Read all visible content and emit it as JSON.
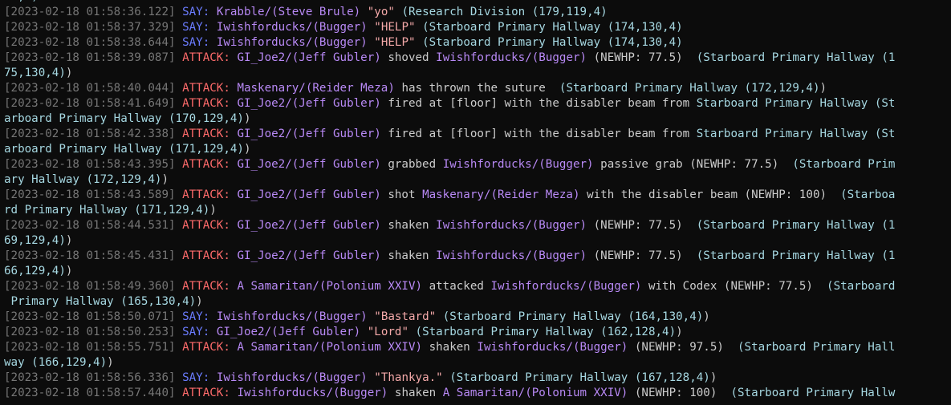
{
  "tags": {
    "say": "SAY:",
    "attack": "ATTACK:"
  },
  "colors": {
    "background": "#0c0c0c",
    "timestamp": "#767676",
    "say_tag": "#6b7cff",
    "attack_tag": "#ff6b6b",
    "actor": "#b889f5",
    "quote": "#f4a9a9",
    "location": "#a6d8e2",
    "text": "#cccccc"
  },
  "entries": [
    {
      "type": "cut",
      "segments": [
        {
          "c": "loc",
          "t": "17,4)"
        }
      ]
    },
    {
      "type": "say",
      "segments": [
        {
          "c": "ts",
          "t": "[2023-02-18 01:58:36.122]"
        },
        {
          "c": "txt",
          "t": " "
        },
        {
          "c": "say",
          "t": "SAY:"
        },
        {
          "c": "txt",
          "t": " "
        },
        {
          "c": "actor",
          "t": "Krabble/(Steve Brule)"
        },
        {
          "c": "txt",
          "t": " "
        },
        {
          "c": "quote",
          "t": "\"yo\""
        },
        {
          "c": "txt",
          "t": " "
        },
        {
          "c": "loc",
          "t": "(Research Division (179,119,4)"
        }
      ]
    },
    {
      "type": "say",
      "segments": [
        {
          "c": "ts",
          "t": "[2023-02-18 01:58:37.329]"
        },
        {
          "c": "txt",
          "t": " "
        },
        {
          "c": "say",
          "t": "SAY:"
        },
        {
          "c": "txt",
          "t": " "
        },
        {
          "c": "actor",
          "t": "Iwishforducks/(Bugger)"
        },
        {
          "c": "txt",
          "t": " "
        },
        {
          "c": "quote",
          "t": "\"HELP\""
        },
        {
          "c": "txt",
          "t": " "
        },
        {
          "c": "loc",
          "t": "(Starboard Primary Hallway (174,130,4)"
        }
      ]
    },
    {
      "type": "say",
      "segments": [
        {
          "c": "ts",
          "t": "[2023-02-18 01:58:38.644]"
        },
        {
          "c": "txt",
          "t": " "
        },
        {
          "c": "say",
          "t": "SAY:"
        },
        {
          "c": "txt",
          "t": " "
        },
        {
          "c": "actor",
          "t": "Iwishforducks/(Bugger)"
        },
        {
          "c": "txt",
          "t": " "
        },
        {
          "c": "quote",
          "t": "\"HELP\""
        },
        {
          "c": "txt",
          "t": " "
        },
        {
          "c": "loc",
          "t": "(Starboard Primary Hallway (174,130,4)"
        }
      ]
    },
    {
      "type": "attack",
      "segments": [
        {
          "c": "ts",
          "t": "[2023-02-18 01:58:39.087]"
        },
        {
          "c": "txt",
          "t": " "
        },
        {
          "c": "atk",
          "t": "ATTACK:"
        },
        {
          "c": "txt",
          "t": " "
        },
        {
          "c": "actor",
          "t": "GI_Joe2/(Jeff Gubler)"
        },
        {
          "c": "txt",
          "t": " shoved "
        },
        {
          "c": "actor",
          "t": "Iwishforducks/(Bugger)"
        },
        {
          "c": "txt",
          "t": " (NEWHP: 77.5)  "
        },
        {
          "c": "loc",
          "t": "(Starboard Primary Hallway (1"
        }
      ]
    },
    {
      "type": "wrap",
      "segments": [
        {
          "c": "loc",
          "t": "75,130,4)"
        },
        {
          "c": "txt",
          "t": ")"
        }
      ]
    },
    {
      "type": "attack",
      "segments": [
        {
          "c": "ts",
          "t": "[2023-02-18 01:58:40.044]"
        },
        {
          "c": "txt",
          "t": " "
        },
        {
          "c": "atk",
          "t": "ATTACK:"
        },
        {
          "c": "txt",
          "t": " "
        },
        {
          "c": "actor",
          "t": "Maskenary/(Reider Meza)"
        },
        {
          "c": "txt",
          "t": " has thrown the suture  "
        },
        {
          "c": "loc",
          "t": "(Starboard Primary Hallway (172,129,4)"
        },
        {
          "c": "txt",
          "t": ")"
        }
      ]
    },
    {
      "type": "attack",
      "segments": [
        {
          "c": "ts",
          "t": "[2023-02-18 01:58:41.649]"
        },
        {
          "c": "txt",
          "t": " "
        },
        {
          "c": "atk",
          "t": "ATTACK:"
        },
        {
          "c": "txt",
          "t": " "
        },
        {
          "c": "actor",
          "t": "GI_Joe2/(Jeff Gubler)"
        },
        {
          "c": "txt",
          "t": " fired at [floor] with the disabler beam from "
        },
        {
          "c": "loc",
          "t": "Starboard Primary Hallway (St"
        }
      ]
    },
    {
      "type": "wrap",
      "segments": [
        {
          "c": "loc",
          "t": "arboard Primary Hallway (170,129,4)"
        },
        {
          "c": "txt",
          "t": ")"
        }
      ]
    },
    {
      "type": "attack",
      "segments": [
        {
          "c": "ts",
          "t": "[2023-02-18 01:58:42.338]"
        },
        {
          "c": "txt",
          "t": " "
        },
        {
          "c": "atk",
          "t": "ATTACK:"
        },
        {
          "c": "txt",
          "t": " "
        },
        {
          "c": "actor",
          "t": "GI_Joe2/(Jeff Gubler)"
        },
        {
          "c": "txt",
          "t": " fired at [floor] with the disabler beam from "
        },
        {
          "c": "loc",
          "t": "Starboard Primary Hallway (St"
        }
      ]
    },
    {
      "type": "wrap",
      "segments": [
        {
          "c": "loc",
          "t": "arboard Primary Hallway (171,129,4)"
        },
        {
          "c": "txt",
          "t": ")"
        }
      ]
    },
    {
      "type": "attack",
      "segments": [
        {
          "c": "ts",
          "t": "[2023-02-18 01:58:43.395]"
        },
        {
          "c": "txt",
          "t": " "
        },
        {
          "c": "atk",
          "t": "ATTACK:"
        },
        {
          "c": "txt",
          "t": " "
        },
        {
          "c": "actor",
          "t": "GI_Joe2/(Jeff Gubler)"
        },
        {
          "c": "txt",
          "t": " grabbed "
        },
        {
          "c": "actor",
          "t": "Iwishforducks/(Bugger)"
        },
        {
          "c": "txt",
          "t": " passive grab (NEWHP: 77.5)  "
        },
        {
          "c": "loc",
          "t": "(Starboard Prim"
        }
      ]
    },
    {
      "type": "wrap",
      "segments": [
        {
          "c": "loc",
          "t": "ary Hallway (172,129,4)"
        },
        {
          "c": "txt",
          "t": ")"
        }
      ]
    },
    {
      "type": "attack",
      "segments": [
        {
          "c": "ts",
          "t": "[2023-02-18 01:58:43.589]"
        },
        {
          "c": "txt",
          "t": " "
        },
        {
          "c": "atk",
          "t": "ATTACK:"
        },
        {
          "c": "txt",
          "t": " "
        },
        {
          "c": "actor",
          "t": "GI_Joe2/(Jeff Gubler)"
        },
        {
          "c": "txt",
          "t": " shot "
        },
        {
          "c": "actor",
          "t": "Maskenary/(Reider Meza)"
        },
        {
          "c": "txt",
          "t": " with the disabler beam (NEWHP: 100)  "
        },
        {
          "c": "loc",
          "t": "(Starboa"
        }
      ]
    },
    {
      "type": "wrap",
      "segments": [
        {
          "c": "loc",
          "t": "rd Primary Hallway (171,129,4)"
        },
        {
          "c": "txt",
          "t": ")"
        }
      ]
    },
    {
      "type": "attack",
      "segments": [
        {
          "c": "ts",
          "t": "[2023-02-18 01:58:44.531]"
        },
        {
          "c": "txt",
          "t": " "
        },
        {
          "c": "atk",
          "t": "ATTACK:"
        },
        {
          "c": "txt",
          "t": " "
        },
        {
          "c": "actor",
          "t": "GI_Joe2/(Jeff Gubler)"
        },
        {
          "c": "txt",
          "t": " shaken "
        },
        {
          "c": "actor",
          "t": "Iwishforducks/(Bugger)"
        },
        {
          "c": "txt",
          "t": " (NEWHP: 77.5)  "
        },
        {
          "c": "loc",
          "t": "(Starboard Primary Hallway (1"
        }
      ]
    },
    {
      "type": "wrap",
      "segments": [
        {
          "c": "loc",
          "t": "69,129,4)"
        },
        {
          "c": "txt",
          "t": ")"
        }
      ]
    },
    {
      "type": "attack",
      "segments": [
        {
          "c": "ts",
          "t": "[2023-02-18 01:58:45.431]"
        },
        {
          "c": "txt",
          "t": " "
        },
        {
          "c": "atk",
          "t": "ATTACK:"
        },
        {
          "c": "txt",
          "t": " "
        },
        {
          "c": "actor",
          "t": "GI_Joe2/(Jeff Gubler)"
        },
        {
          "c": "txt",
          "t": " shaken "
        },
        {
          "c": "actor",
          "t": "Iwishforducks/(Bugger)"
        },
        {
          "c": "txt",
          "t": " (NEWHP: 77.5)  "
        },
        {
          "c": "loc",
          "t": "(Starboard Primary Hallway (1"
        }
      ]
    },
    {
      "type": "wrap",
      "segments": [
        {
          "c": "loc",
          "t": "66,129,4)"
        },
        {
          "c": "txt",
          "t": ")"
        }
      ]
    },
    {
      "type": "attack",
      "segments": [
        {
          "c": "ts",
          "t": "[2023-02-18 01:58:49.360]"
        },
        {
          "c": "txt",
          "t": " "
        },
        {
          "c": "atk",
          "t": "ATTACK:"
        },
        {
          "c": "txt",
          "t": " "
        },
        {
          "c": "actor",
          "t": "A Samaritan/(Polonium XXIV)"
        },
        {
          "c": "txt",
          "t": " attacked "
        },
        {
          "c": "actor",
          "t": "Iwishforducks/(Bugger)"
        },
        {
          "c": "txt",
          "t": " with Codex (NEWHP: 77.5)  "
        },
        {
          "c": "loc",
          "t": "(Starboard"
        }
      ]
    },
    {
      "type": "wrap",
      "segments": [
        {
          "c": "loc",
          "t": " Primary Hallway (165,130,4)"
        },
        {
          "c": "txt",
          "t": ")"
        }
      ]
    },
    {
      "type": "say",
      "segments": [
        {
          "c": "ts",
          "t": "[2023-02-18 01:58:50.071]"
        },
        {
          "c": "txt",
          "t": " "
        },
        {
          "c": "say",
          "t": "SAY:"
        },
        {
          "c": "txt",
          "t": " "
        },
        {
          "c": "actor",
          "t": "Iwishforducks/(Bugger)"
        },
        {
          "c": "txt",
          "t": " "
        },
        {
          "c": "quote",
          "t": "\"Bastard\""
        },
        {
          "c": "txt",
          "t": " "
        },
        {
          "c": "loc",
          "t": "(Starboard Primary Hallway (164,130,4)"
        },
        {
          "c": "txt",
          "t": ")"
        }
      ]
    },
    {
      "type": "say",
      "segments": [
        {
          "c": "ts",
          "t": "[2023-02-18 01:58:50.253]"
        },
        {
          "c": "txt",
          "t": " "
        },
        {
          "c": "say",
          "t": "SAY:"
        },
        {
          "c": "txt",
          "t": " "
        },
        {
          "c": "actor",
          "t": "GI_Joe2/(Jeff Gubler)"
        },
        {
          "c": "txt",
          "t": " "
        },
        {
          "c": "quote",
          "t": "\"Lord\""
        },
        {
          "c": "txt",
          "t": " "
        },
        {
          "c": "loc",
          "t": "(Starboard Primary Hallway (162,128,4)"
        },
        {
          "c": "txt",
          "t": ")"
        }
      ]
    },
    {
      "type": "attack",
      "segments": [
        {
          "c": "ts",
          "t": "[2023-02-18 01:58:55.751]"
        },
        {
          "c": "txt",
          "t": " "
        },
        {
          "c": "atk",
          "t": "ATTACK:"
        },
        {
          "c": "txt",
          "t": " "
        },
        {
          "c": "actor",
          "t": "A Samaritan/(Polonium XXIV)"
        },
        {
          "c": "txt",
          "t": " shaken "
        },
        {
          "c": "actor",
          "t": "Iwishforducks/(Bugger)"
        },
        {
          "c": "txt",
          "t": " (NEWHP: 97.5)  "
        },
        {
          "c": "loc",
          "t": "(Starboard Primary Hall"
        }
      ]
    },
    {
      "type": "wrap",
      "segments": [
        {
          "c": "loc",
          "t": "way (166,129,4)"
        },
        {
          "c": "txt",
          "t": ")"
        }
      ]
    },
    {
      "type": "say",
      "segments": [
        {
          "c": "ts",
          "t": "[2023-02-18 01:58:56.336]"
        },
        {
          "c": "txt",
          "t": " "
        },
        {
          "c": "say",
          "t": "SAY:"
        },
        {
          "c": "txt",
          "t": " "
        },
        {
          "c": "actor",
          "t": "Iwishforducks/(Bugger)"
        },
        {
          "c": "txt",
          "t": " "
        },
        {
          "c": "quote",
          "t": "\"Thankya.\""
        },
        {
          "c": "txt",
          "t": " "
        },
        {
          "c": "loc",
          "t": "(Starboard Primary Hallway (167,128,4)"
        },
        {
          "c": "txt",
          "t": ")"
        }
      ]
    },
    {
      "type": "attack",
      "segments": [
        {
          "c": "ts",
          "t": "[2023-02-18 01:58:57.440]"
        },
        {
          "c": "txt",
          "t": " "
        },
        {
          "c": "atk",
          "t": "ATTACK:"
        },
        {
          "c": "txt",
          "t": " "
        },
        {
          "c": "actor",
          "t": "Iwishforducks/(Bugger)"
        },
        {
          "c": "txt",
          "t": " shaken "
        },
        {
          "c": "actor",
          "t": "A Samaritan/(Polonium XXIV)"
        },
        {
          "c": "txt",
          "t": " (NEWHP: 100)  "
        },
        {
          "c": "loc",
          "t": "(Starboard Primary Hallw"
        }
      ]
    }
  ]
}
